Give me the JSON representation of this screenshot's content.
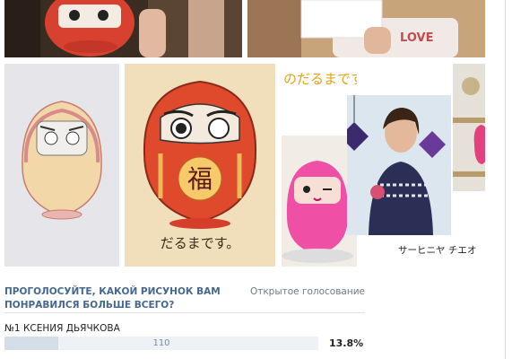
{
  "photos": {
    "daruma_caption": "だるまです。",
    "banner_text": "のだるまです。",
    "cut_caption": "サーヒニヤ チエオ",
    "love_text": "LOVE",
    "fortune_kanji": "福"
  },
  "poll": {
    "title": "ПРОГОЛОСУЙТЕ, КАКОЙ РИСУНОК ВАМ ПОНРАВИЛСЯ БОЛЬШЕ ВСЕГО?",
    "type": "Открытое голосование",
    "options": [
      {
        "label": "№1 КСЕНИЯ ДЬЯЧКОВА",
        "count": "110",
        "percent": "13.8%",
        "share": 0.17
      }
    ]
  }
}
